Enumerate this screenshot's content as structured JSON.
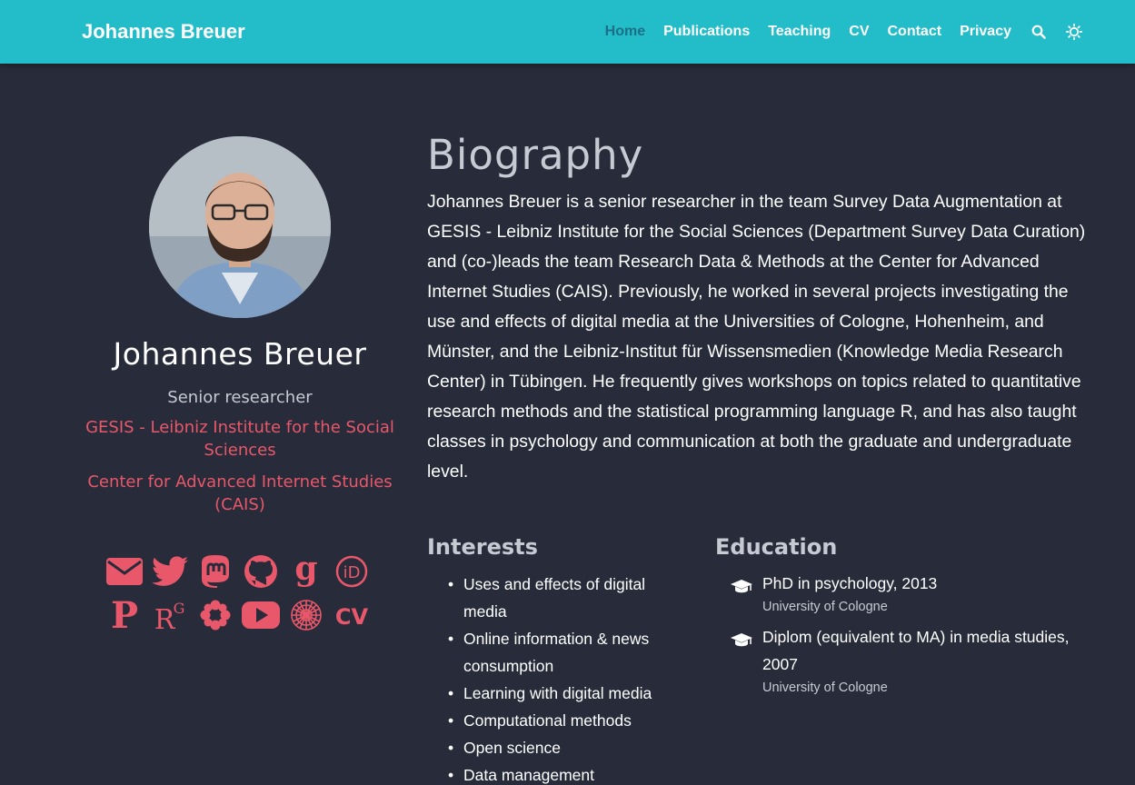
{
  "navbar": {
    "brand": "Johannes Breuer",
    "links": [
      "Home",
      "Publications",
      "Teaching",
      "CV",
      "Contact",
      "Privacy"
    ],
    "active": "Home",
    "icons": [
      "search-icon",
      "theme-toggle-icon"
    ],
    "color": "#23bdc9"
  },
  "profile": {
    "name": "Johannes Breuer",
    "role": "Senior researcher",
    "org1": "GESIS - Leibniz Institute for the Social Sciences",
    "org2": "Center for Advanced Internet Studies (CAIS)",
    "accent": "#e8586a",
    "social_icons": [
      "email-icon",
      "twitter-icon",
      "mastodon-icon",
      "github-icon",
      "google-scholar-icon",
      "orcid-icon",
      "publons-icon",
      "researchgate-icon",
      "osf-icon",
      "youtube-icon",
      "openalex-icon",
      "cv-icon"
    ],
    "researchgate_label": "R",
    "researchgate_sup": "G",
    "cv_label": "CV",
    "publons_label": "P"
  },
  "biography": {
    "title": "Biography",
    "text": "Johannes Breuer is a senior researcher in the team Survey Data Augmentation at GESIS - Leibniz Institute for the Social Sciences (Department Survey Data Curation) and (co-)leads the team Research Data & Methods at the Center for Advanced Internet Studies (CAIS). Previously, he worked in several projects investigating the use and effects of digital media at the Universities of Cologne, Hohenheim, and Münster, and the Leibniz-Institut für Wissensmedien (Knowledge Media Research Center) in Tübingen. He frequently gives workshops on topics related to quantitative research methods and the statistical programming language R, and has also taught classes in psychology and communication at both the graduate and undergraduate level."
  },
  "interests": {
    "title": "Interests",
    "items": [
      "Uses and effects of digital media",
      "Online information & news consumption",
      "Learning with digital media",
      "Computational methods",
      "Open science",
      "Data management"
    ]
  },
  "education": {
    "title": "Education",
    "items": [
      {
        "degree": "PhD in psychology, 2013",
        "institution": "University of Cologne"
      },
      {
        "degree": "Diplom (equivalent to MA) in media studies, 2007",
        "institution": "University of Cologne"
      }
    ]
  }
}
